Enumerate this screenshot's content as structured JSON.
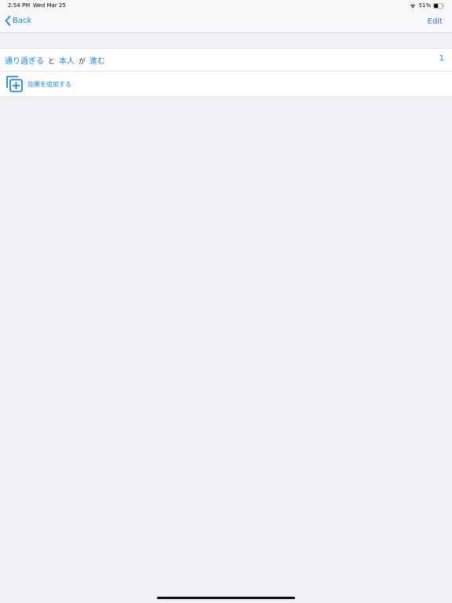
{
  "status_bar": {
    "time": "2:54 PM",
    "date": "Wed Mar 25",
    "battery": "51%",
    "battery_level": 0.51,
    "icons": [
      "wifi-icon",
      "battery-icon"
    ]
  },
  "nav": {
    "back_label": "Back",
    "edit_label": "Edit",
    "icons": [
      "chevron-left-icon"
    ]
  },
  "rule": {
    "verb": "通り過ぎる",
    "particle_1": "と",
    "subject": "本人",
    "particle_2": "が",
    "action": "進む",
    "count": "1"
  },
  "add_effect": {
    "label": "効果を追加する",
    "icon": "add-effect-icon"
  },
  "colors": {
    "accent": "#1a84e0",
    "background": "#f2f1f6",
    "card": "#ffffff",
    "bar": "#f8f8fa"
  }
}
